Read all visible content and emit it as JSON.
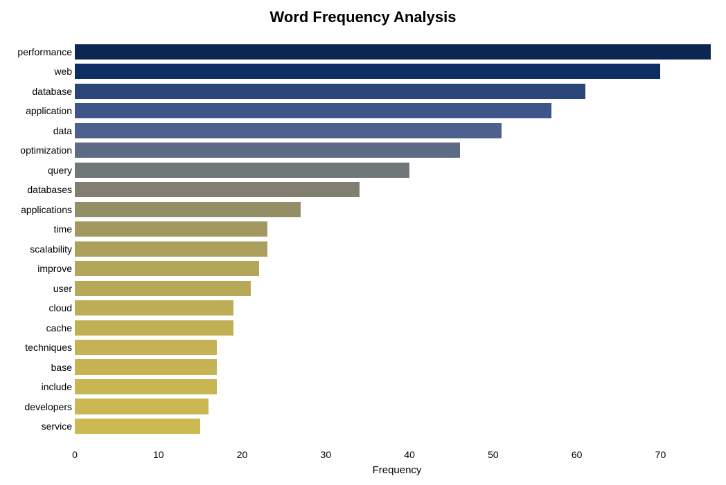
{
  "chart_data": {
    "type": "bar",
    "orientation": "horizontal",
    "title": "Word Frequency Analysis",
    "xlabel": "Frequency",
    "ylabel": "",
    "xlim": [
      0,
      77
    ],
    "xticks": [
      0,
      10,
      20,
      30,
      40,
      50,
      60,
      70
    ],
    "categories": [
      "performance",
      "web",
      "database",
      "application",
      "data",
      "optimization",
      "query",
      "databases",
      "applications",
      "time",
      "scalability",
      "improve",
      "user",
      "cloud",
      "cache",
      "techniques",
      "base",
      "include",
      "developers",
      "service"
    ],
    "values": [
      76,
      70,
      61,
      57,
      51,
      46,
      40,
      34,
      27,
      23,
      23,
      22,
      21,
      19,
      19,
      17,
      17,
      17,
      16,
      15
    ],
    "colors": [
      "#0a2651",
      "#0d2e63",
      "#2a4679",
      "#3d5588",
      "#4e618e",
      "#5e6b84",
      "#6f7779",
      "#817f70",
      "#948e67",
      "#a49861",
      "#ac9f5c",
      "#b3a559",
      "#b8a958",
      "#bdad56",
      "#c0af55",
      "#c4b254",
      "#c6b454",
      "#c8b553",
      "#cab753",
      "#ccb952"
    ]
  }
}
